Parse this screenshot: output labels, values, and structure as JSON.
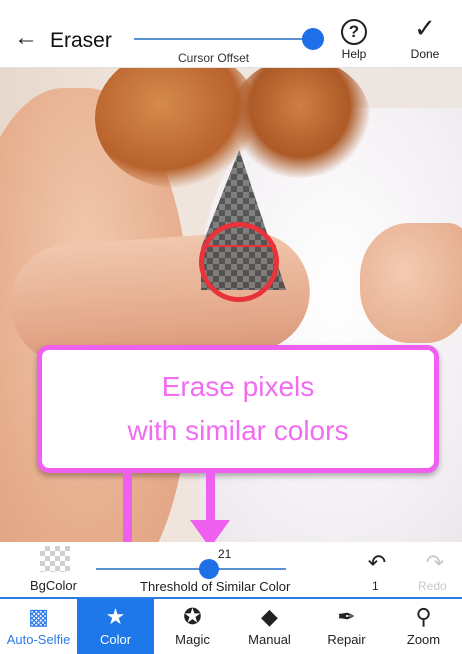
{
  "header": {
    "title": "Eraser",
    "slider_label": "Cursor Offset",
    "help_label": "Help",
    "done_label": "Done"
  },
  "callout": {
    "line1": "Erase pixels",
    "line2": "with similar colors"
  },
  "threshold": {
    "bgcolor_label": "BgColor",
    "value": "21",
    "label": "Threshold of Similar Color",
    "undo_count": "1",
    "redo_label": "Redo"
  },
  "tabs": [
    {
      "label": "Auto-Selfie",
      "icon": "face-scan-icon"
    },
    {
      "label": "Color",
      "icon": "star-icon"
    },
    {
      "label": "Magic",
      "icon": "magic-star-circle-icon"
    },
    {
      "label": "Manual",
      "icon": "eraser-icon"
    },
    {
      "label": "Repair",
      "icon": "brush-icon"
    },
    {
      "label": "Zoom",
      "icon": "zoom-icon"
    }
  ],
  "colors": {
    "accent": "#1e78ea",
    "callout": "#f060f0",
    "cursor": "#e8333b"
  }
}
